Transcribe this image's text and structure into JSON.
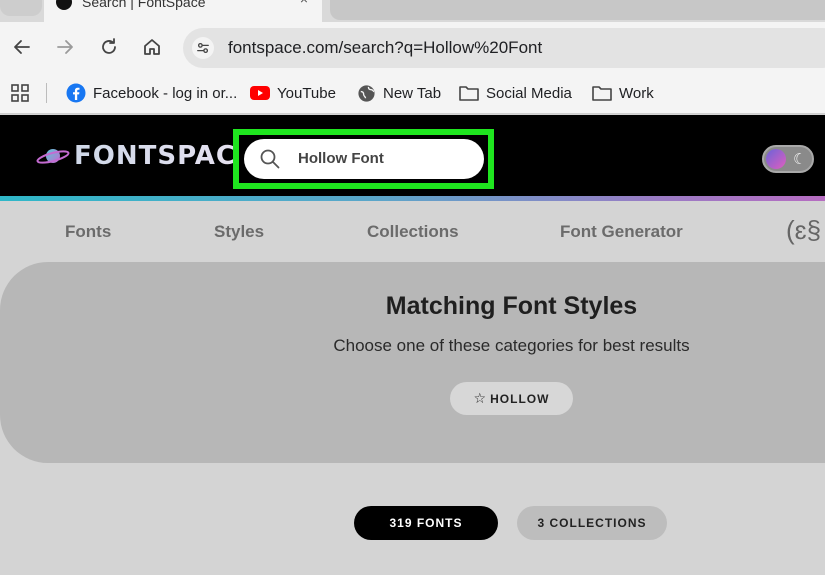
{
  "browser": {
    "tab_title": "Search | FontSpace",
    "tab_close": "×",
    "url": "fontspace.com/search?q=Hollow%20Font",
    "bookmarks": [
      {
        "label": "Facebook - log in or...",
        "icon": "facebook-icon"
      },
      {
        "label": "YouTube",
        "icon": "youtube-icon"
      },
      {
        "label": "New Tab",
        "icon": "globe-icon"
      },
      {
        "label": "Social Media",
        "icon": "folder-icon"
      },
      {
        "label": "Work",
        "icon": "folder-icon"
      }
    ]
  },
  "site": {
    "logo_text": "FONTSPACE",
    "search_value": "Hollow Font",
    "highlight_color": "#1fe61f",
    "nav": [
      "Fonts",
      "Styles",
      "Collections",
      "Font Generator"
    ],
    "nav_extra_glyph": "(ɛ§",
    "matching": {
      "title": "Matching Font Styles",
      "subtitle": "Choose one of these categories for best results",
      "chip": "HOLLOW"
    },
    "results": {
      "fonts_tab": "319 FONTS",
      "collections_tab": "3 COLLECTIONS"
    }
  }
}
